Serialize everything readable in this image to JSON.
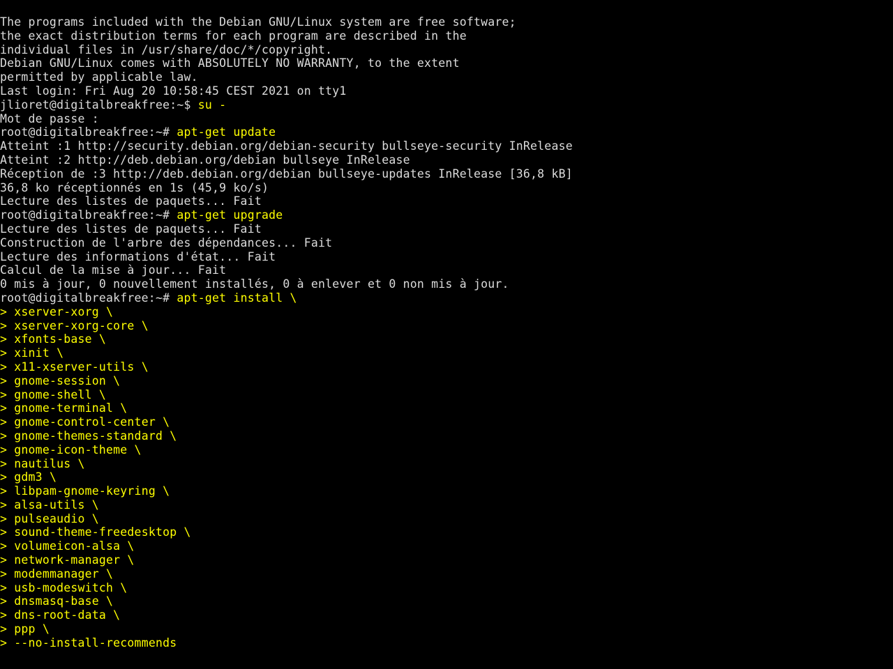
{
  "intro": [
    "The programs included with the Debian GNU/Linux system are free software;",
    "the exact distribution terms for each program are described in the",
    "individual files in /usr/share/doc/*/copyright.",
    "",
    "Debian GNU/Linux comes with ABSOLUTELY NO WARRANTY, to the extent",
    "permitted by applicable law.",
    "Last login: Fri Aug 20 10:58:45 CEST 2021 on tty1"
  ],
  "user_prompt_prefix": "jlioret@digitalbreakfree:~$ ",
  "user_cmd1": "su -",
  "pwline": "Mot de passe :",
  "root_prompt_prefix": "root@digitalbreakfree:~# ",
  "root_cmd1": "apt-get update",
  "apt_update_out": [
    "Atteint :1 http://security.debian.org/debian-security bullseye-security InRelease",
    "Atteint :2 http://deb.debian.org/debian bullseye InRelease",
    "Réception de :3 http://deb.debian.org/debian bullseye-updates InRelease [36,8 kB]",
    "36,8 ko réceptionnés en 1s (45,9 ko/s)",
    "Lecture des listes de paquets... Fait"
  ],
  "root_cmd2": "apt-get upgrade",
  "apt_upgrade_out": [
    "Lecture des listes de paquets... Fait",
    "Construction de l'arbre des dépendances... Fait",
    "Lecture des informations d'état... Fait",
    "Calcul de la mise à jour... Fait",
    "0 mis à jour, 0 nouvellement installés, 0 à enlever et 0 non mis à jour."
  ],
  "root_cmd3": "apt-get install \\",
  "cont_prefix": "> ",
  "install_args": [
    "xserver-xorg \\",
    "xserver-xorg-core \\",
    "xfonts-base \\",
    "xinit \\",
    "x11-xserver-utils \\",
    "gnome-session \\",
    "gnome-shell \\",
    "gnome-terminal \\",
    "gnome-control-center \\",
    "gnome-themes-standard \\",
    "gnome-icon-theme \\",
    "nautilus \\",
    "gdm3 \\",
    "libpam-gnome-keyring \\",
    "alsa-utils \\",
    "pulseaudio \\",
    "sound-theme-freedesktop \\",
    "volumeicon-alsa \\",
    "network-manager \\",
    "modemmanager \\",
    "usb-modeswitch \\",
    "dnsmasq-base \\",
    "dns-root-data \\",
    "ppp \\",
    "--no-install-recommends"
  ]
}
